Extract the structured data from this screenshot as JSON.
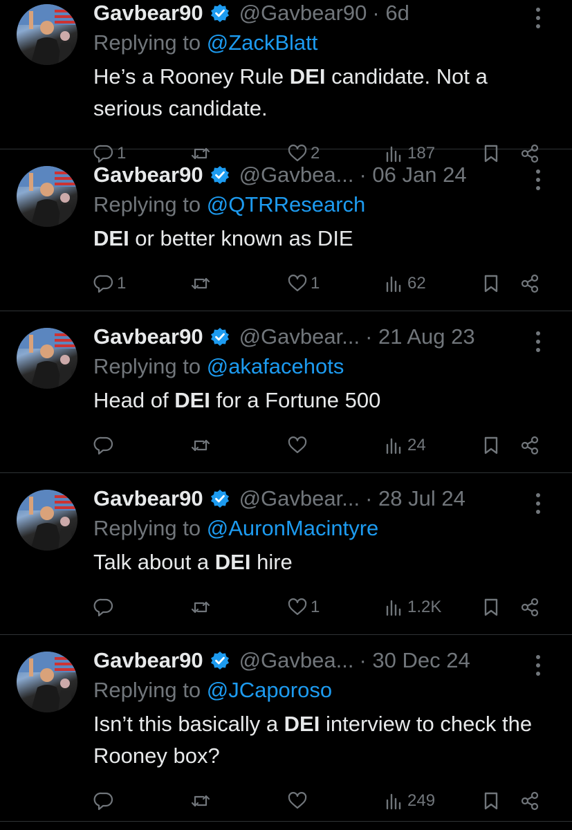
{
  "tweets": [
    {
      "name": "Gavbear90",
      "handle": "@Gavbear90",
      "date": "· 6d",
      "replying_prefix": "Replying to ",
      "replying_to": "@ZackBlatt",
      "text_parts": [
        "He’s a Rooney Rule ",
        "DEI",
        " candidate. Not a serious candidate."
      ],
      "stats": {
        "replies": "1",
        "retweets": "",
        "likes": "2",
        "views": "187"
      }
    },
    {
      "name": "Gavbear90",
      "handle": "@Gavbea...",
      "date": "· 06 Jan 24",
      "replying_prefix": "Replying to ",
      "replying_to": "@QTRResearch",
      "text_parts": [
        "",
        "DEI",
        " or better known as DIE"
      ],
      "stats": {
        "replies": "1",
        "retweets": "",
        "likes": "1",
        "views": "62"
      }
    },
    {
      "name": "Gavbear90",
      "handle": "@Gavbear...",
      "date": "· 21 Aug 23",
      "replying_prefix": "Replying to ",
      "replying_to": "@akafacehots",
      "text_parts": [
        "Head of ",
        "DEI",
        " for a Fortune 500"
      ],
      "stats": {
        "replies": "",
        "retweets": "",
        "likes": "",
        "views": "24"
      }
    },
    {
      "name": "Gavbear90",
      "handle": "@Gavbear...",
      "date": "· 28 Jul 24",
      "replying_prefix": "Replying to ",
      "replying_to": "@AuronMacintyre",
      "text_parts": [
        "Talk about a ",
        "DEI",
        " hire"
      ],
      "stats": {
        "replies": "",
        "retweets": "",
        "likes": "1",
        "views": "1.2K"
      }
    },
    {
      "name": "Gavbear90",
      "handle": "@Gavbea...",
      "date": "· 30 Dec 24",
      "replying_prefix": "Replying to ",
      "replying_to": "@JCaporoso",
      "text_parts": [
        "Isn’t this basically a ",
        "DEI",
        " interview to check the Rooney box?"
      ],
      "stats": {
        "replies": "",
        "retweets": "",
        "likes": "",
        "views": "249"
      }
    }
  ],
  "icons": {
    "verified": "verified-badge-icon",
    "more": "more-vertical-icon",
    "reply": "reply-icon",
    "retweet": "retweet-icon",
    "like": "heart-icon",
    "views": "views-icon",
    "bookmark": "bookmark-icon",
    "share": "share-icon"
  },
  "colors": {
    "background": "#000000",
    "text": "#e7e9ea",
    "muted": "#71767b",
    "mention": "#1d9bf0",
    "verified": "#1d9bf0"
  }
}
